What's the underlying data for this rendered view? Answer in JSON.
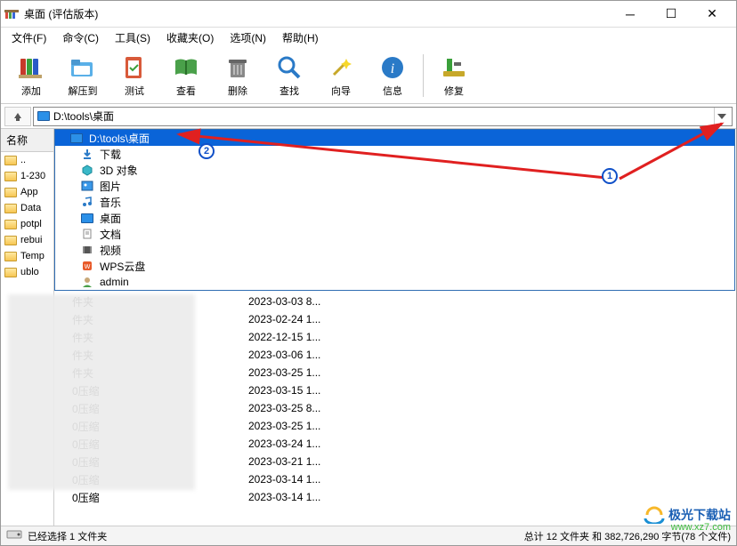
{
  "title": "桌面 (评估版本)",
  "menu": [
    "文件(F)",
    "命令(C)",
    "工具(S)",
    "收藏夹(O)",
    "选项(N)",
    "帮助(H)"
  ],
  "toolbar": [
    {
      "key": "add",
      "label": "添加"
    },
    {
      "key": "extract",
      "label": "解压到"
    },
    {
      "key": "test",
      "label": "测试"
    },
    {
      "key": "view",
      "label": "查看"
    },
    {
      "key": "delete",
      "label": "删除"
    },
    {
      "key": "find",
      "label": "查找"
    },
    {
      "key": "wizard",
      "label": "向导"
    },
    {
      "key": "info",
      "label": "信息"
    }
  ],
  "toolbar_repair": {
    "label": "修复"
  },
  "path": "D:\\tools\\桌面",
  "dropdown": [
    {
      "icon": "monitor",
      "label": "D:\\tools\\桌面",
      "selected": true
    },
    {
      "icon": "download",
      "label": "下载"
    },
    {
      "icon": "cube",
      "label": "3D 对象"
    },
    {
      "icon": "picture",
      "label": "图片"
    },
    {
      "icon": "music",
      "label": "音乐"
    },
    {
      "icon": "monitor",
      "label": "桌面"
    },
    {
      "icon": "doc",
      "label": "文档"
    },
    {
      "icon": "video",
      "label": "视频"
    },
    {
      "icon": "wps",
      "label": "WPS云盘"
    },
    {
      "icon": "user",
      "label": "admin"
    }
  ],
  "side_header": "名称",
  "side_items": [
    "..",
    "1-230",
    "App",
    "Data",
    "potpl",
    "rebui",
    "Temp",
    "ublo"
  ],
  "file_col_type": "文件夹",
  "file_col_zip": "0压缩",
  "rows": [
    {
      "t": "件夹",
      "d": "2023-03-03 8..."
    },
    {
      "t": "件夹",
      "d": "2023-02-24 1..."
    },
    {
      "t": "件夹",
      "d": "2022-12-15 1..."
    },
    {
      "t": "件夹",
      "d": "2023-03-06 1..."
    },
    {
      "t": "件夹",
      "d": "2023-03-25 1..."
    },
    {
      "t": "0压缩",
      "d": "2023-03-15 1..."
    },
    {
      "t": "0压缩",
      "d": "2023-03-25 8..."
    },
    {
      "t": "0压缩",
      "d": "2023-03-25 1..."
    },
    {
      "t": "0压缩",
      "d": "2023-03-24 1..."
    },
    {
      "t": "0压缩",
      "d": "2023-03-21 1..."
    },
    {
      "t": "0压缩",
      "d": "2023-03-14 1..."
    },
    {
      "t": "0压缩",
      "d": "2023-03-14 1..."
    }
  ],
  "status_left": "已经选择 1 文件夹",
  "status_right": "总计 12 文件夹 和 382,726,290 字节(78 个文件)",
  "watermark_text": "极光下载站",
  "watermark_url": "www.xz7.com"
}
